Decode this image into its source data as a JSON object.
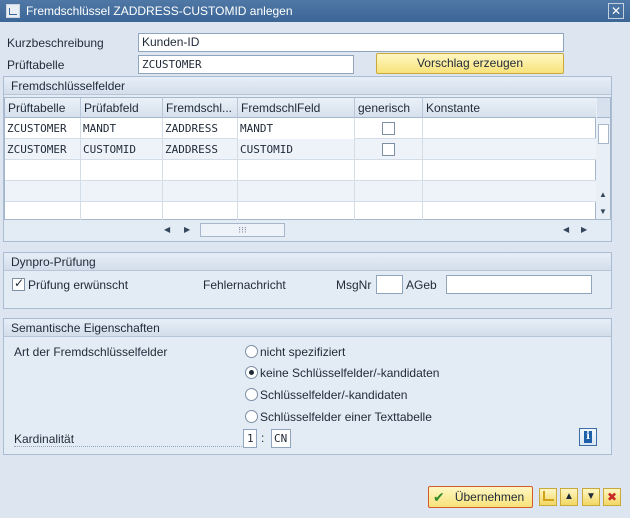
{
  "window": {
    "title": "Fremdschlüssel ZADDRESS-CUSTOMID anlegen"
  },
  "form": {
    "kurz_label": "Kurzbeschreibung",
    "kurz_value": "Kunden-ID",
    "pruef_label": "Prüftabelle",
    "pruef_value": "ZCUSTOMER",
    "vorschlag_button": "Vorschlag erzeugen"
  },
  "fk_section": {
    "title": "Fremdschlüsselfelder",
    "columns": [
      "Prüftabelle",
      "Prüfabfeld",
      "Fremdschl...",
      "FremdschlFeld",
      "generisch",
      "Konstante"
    ],
    "rows": [
      [
        "ZCUSTOMER",
        "MANDT",
        "ZADDRESS",
        "MANDT",
        "",
        ""
      ],
      [
        "ZCUSTOMER",
        "CUSTOMID",
        "ZADDRESS",
        "CUSTOMID",
        "",
        ""
      ]
    ]
  },
  "dynpro": {
    "title": "Dynpro-Prüfung",
    "checkbox_label": "Prüfung erwünscht",
    "fehler_label": "Fehlernachricht",
    "msgnr_label": "MsgNr",
    "msgnr_value": "",
    "ageb_label": "AGeb",
    "ageb_value": ""
  },
  "semantic": {
    "title": "Semantische Eigenschaften",
    "art_label": "Art der Fremdschlüsselfelder",
    "options": [
      "nicht spezifiziert",
      "keine Schlüsselfelder/-kandidaten",
      "Schlüsselfelder/-kandidaten",
      "Schlüsselfelder einer Texttabelle"
    ],
    "kard_label": "Kardinalität",
    "kard_left": "1",
    "kard_sep": ":",
    "kard_right": "CN"
  },
  "footer": {
    "uebernehmen": "Übernehmen"
  }
}
